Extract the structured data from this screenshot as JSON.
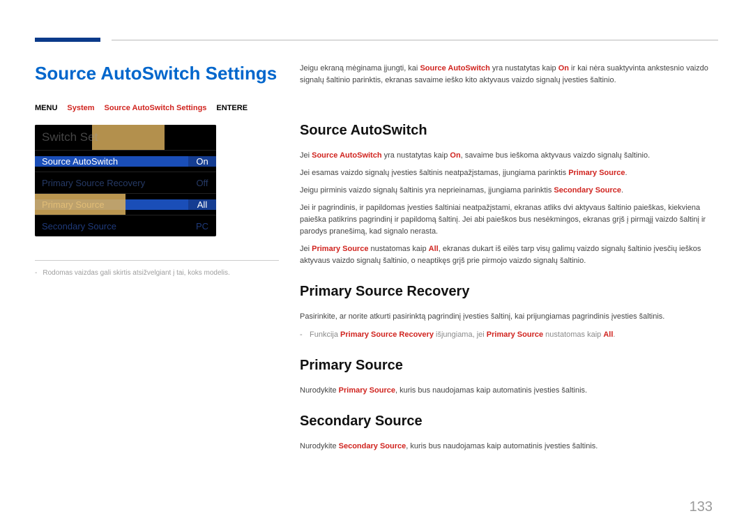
{
  "page_number": "133",
  "main_title": "Source AutoSwitch Settings",
  "breadcrumb": {
    "menu": "MENU",
    "system": "System",
    "setting": "Source AutoSwitch Settings",
    "enter": "ENTERE"
  },
  "panel": {
    "header_partial": "Switch Set",
    "rows": [
      {
        "label": "Source AutoSwitch",
        "value": "On"
      },
      {
        "label": "Primary Source Recovery",
        "value": "Off"
      },
      {
        "label": "Primary Source",
        "value": "All"
      },
      {
        "label": "Secondary Source",
        "value": "PC"
      }
    ]
  },
  "footnote": "Rodomas vaizdas gali skirtis atsižvelgiant į tai, koks modelis.",
  "intro": {
    "p1a": "Jeigu ekraną mėginama įjungti, kai ",
    "p1b": " yra nustatytas kaip ",
    "p1c": " ir kai nėra suaktyvinta ankstesnio vaizdo signalų šaltinio parinktis, ekranas savaime ieško kito aktyvaus vaizdo signalų įvesties šaltinio.",
    "term_sas": "Source AutoSwitch",
    "term_on": "On"
  },
  "sec1": {
    "h": "Source AutoSwitch",
    "p1a": "Jei ",
    "p1b": " yra nustatytas kaip ",
    "p1c": ", savaime bus ieškoma aktyvaus vaizdo signalų šaltinio.",
    "p2a": "Jei esamas vaizdo signalų įvesties šaltinis neatpažįstamas, įjungiama parinktis ",
    "p2term": "Primary Source",
    "p2end": ".",
    "p3a": "Jeigu pirminis vaizdo signalų šaltinis yra neprieinamas, įjungiama parinktis ",
    "p3term": "Secondary Source",
    "p3end": ".",
    "p4": "Jei ir pagrindinis, ir papildomas įvesties šaltiniai neatpažįstami, ekranas atliks dvi aktyvaus šaltinio paieškas, kiekviena paieška patikrins pagrindinį ir papildomą šaltinį. Jei abi paieškos bus nesėkmingos, ekranas grįš į pirmąjį vaizdo šaltinį ir parodys pranešimą, kad signalo nerasta.",
    "p5a": "Jei ",
    "p5term1": "Primary Source",
    "p5b": " nustatomas kaip ",
    "p5term2": "All",
    "p5c": ", ekranas dukart iš eilės tarp visų galimų vaizdo signalų šaltinio įvesčių ieškos aktyvaus vaizdo signalų šaltinio, o neaptikęs grįš prie pirmojo vaizdo signalų šaltinio."
  },
  "sec2": {
    "h": "Primary Source Recovery",
    "p1": "Pasirinkite, ar norite atkurti pasirinktą pagrindinį įvesties šaltinį, kai prijungiamas pagrindinis įvesties šaltinis.",
    "note_a": "Funkcija ",
    "note_t1": "Primary Source Recovery",
    "note_b": " išjungiama, jei ",
    "note_t2": "Primary Source",
    "note_c": " nustatomas kaip ",
    "note_t3": "All",
    "note_end": "."
  },
  "sec3": {
    "h": "Primary Source",
    "p_a": "Nurodykite ",
    "p_t": "Primary Source",
    "p_b": ", kuris bus naudojamas kaip automatinis įvesties šaltinis."
  },
  "sec4": {
    "h": "Secondary Source",
    "p_a": "Nurodykite ",
    "p_t": "Secondary Source",
    "p_b": ", kuris bus naudojamas kaip automatinis įvesties šaltinis."
  }
}
